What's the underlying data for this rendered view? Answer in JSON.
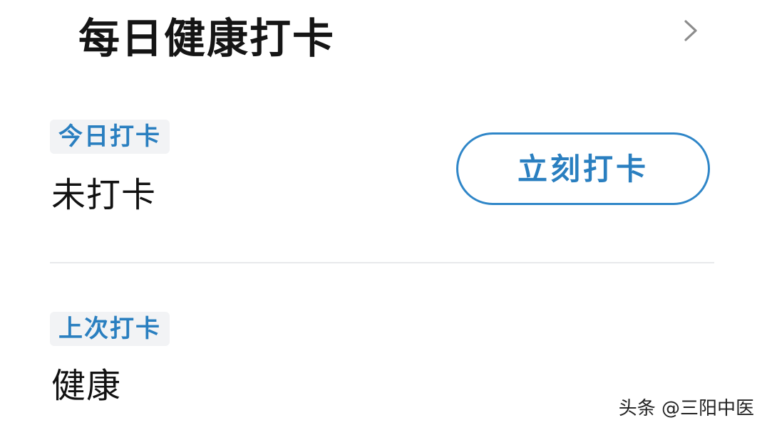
{
  "header": {
    "title": "每日健康打卡",
    "chevron_icon": "chevron-right-icon"
  },
  "today": {
    "tag": "今日打卡",
    "status": "未打卡",
    "button_label": "立刻打卡"
  },
  "last": {
    "tag": "上次打卡",
    "status": "健康"
  },
  "watermark": "头条 @三阳中医",
  "colors": {
    "accent": "#2a7fc0",
    "tag_bg": "#f2f3f5",
    "divider": "#e8e9eb"
  }
}
